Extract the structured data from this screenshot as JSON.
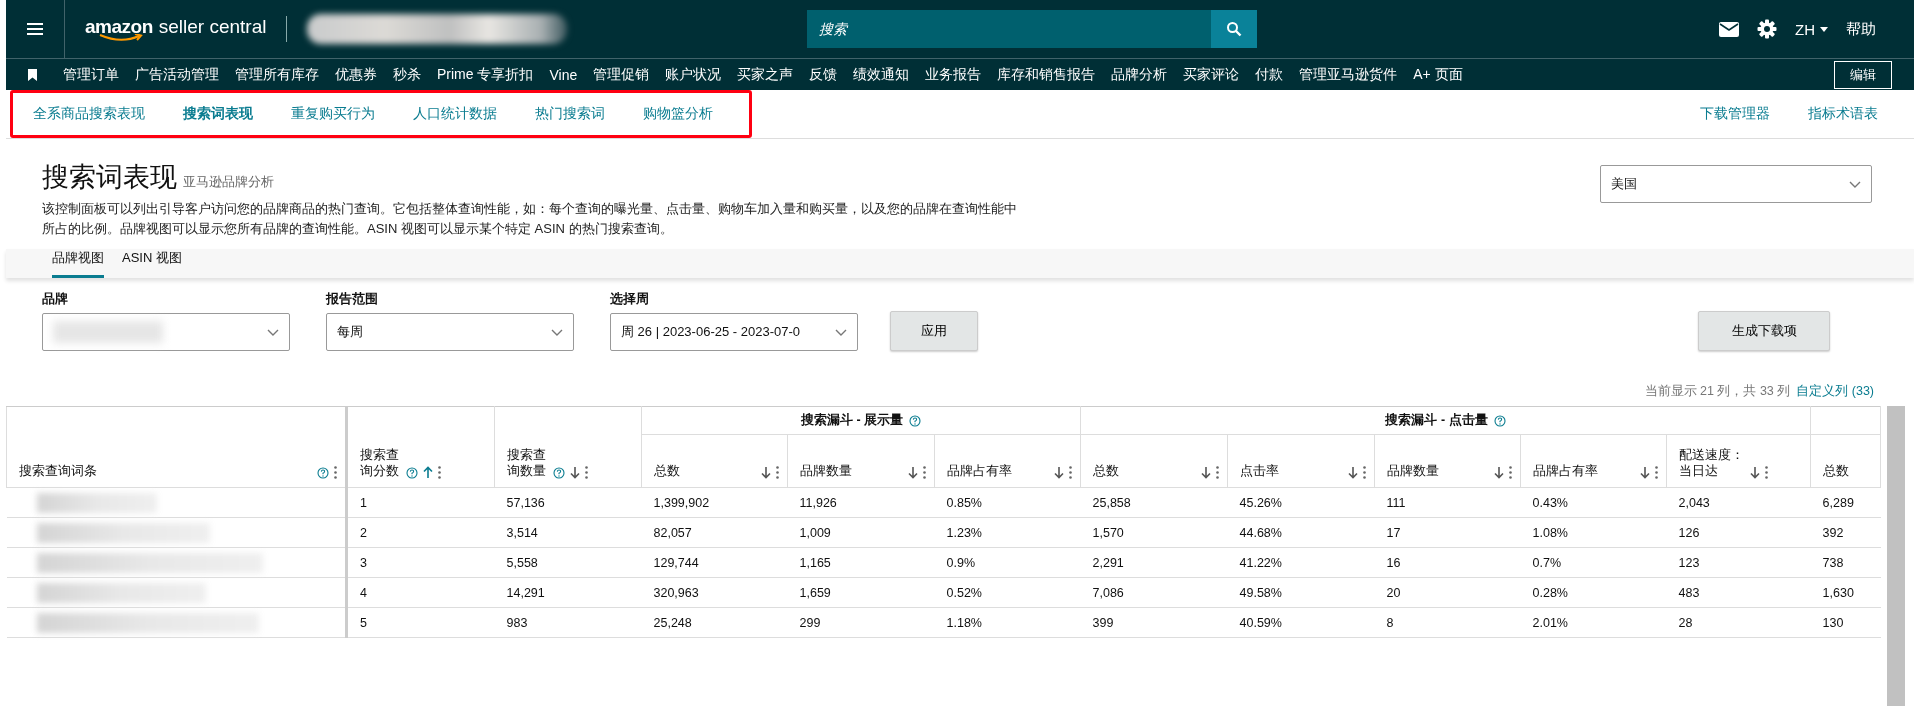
{
  "top_bar": {
    "logo_brand": "amazon",
    "logo_product": "seller central",
    "search": {
      "placeholder": "搜索"
    },
    "language": "ZH",
    "help": "帮助"
  },
  "nav": {
    "items": [
      "管理订单",
      "广告活动管理",
      "管理所有库存",
      "优惠券",
      "秒杀",
      "Prime 专享折扣",
      "Vine",
      "管理促销",
      "账户状况",
      "买家之声",
      "反馈",
      "绩效通知",
      "业务报告",
      "库存和销售报告",
      "品牌分析",
      "买家评论",
      "付款",
      "管理亚马逊货件",
      "A+ 页面"
    ],
    "edit_button": "编辑"
  },
  "subnav": {
    "highlighted": true,
    "items": [
      {
        "label": "全系商品搜索表现",
        "selected": false
      },
      {
        "label": "搜索词表现",
        "selected": true
      },
      {
        "label": "重复购买行为",
        "selected": false
      },
      {
        "label": "人口统计数据",
        "selected": false
      },
      {
        "label": "热门搜索词",
        "selected": false
      },
      {
        "label": "购物篮分析",
        "selected": false
      }
    ],
    "links": [
      "下载管理器",
      "指标术语表"
    ]
  },
  "page": {
    "title": "搜索词表现",
    "subtitle": "亚马逊品牌分析",
    "description": "该控制面板可以列出引导客户访问您的品牌商品的热门查询。它包括整体查询性能，如：每个查询的曝光量、点击量、购物车加入量和购买量，以及您的品牌在查询性能中所占的比例。品牌视图可以显示您所有品牌的查询性能。ASIN 视图可以显示某个特定 ASIN 的热门搜索查询。",
    "marketplace": "美国"
  },
  "view_tabs": [
    {
      "label": "品牌视图",
      "selected": true
    },
    {
      "label": "ASIN 视图",
      "selected": false
    }
  ],
  "filters": [
    {
      "label": "品牌",
      "value_blurred": true
    },
    {
      "label": "报告范围",
      "value": "每周"
    },
    {
      "label": "选择周",
      "value": "周 26 | 2023-06-25 - 2023-07-0"
    }
  ],
  "apply_button": "应用",
  "generate_button": "生成下载项",
  "columns_info": {
    "text": "当前显示 21 列，共 33 列",
    "link": "自定义列 (33)"
  },
  "table": {
    "header": [
      {
        "kind": "column",
        "label": "搜索查询词条",
        "help": true,
        "menu": true
      },
      {
        "kind": "column",
        "label": "搜索查询分数",
        "help": true,
        "sorted": true,
        "menu": true
      },
      {
        "kind": "column",
        "label": "搜索查询数量",
        "help": true,
        "sorted": false,
        "menu": true
      },
      {
        "kind": "group",
        "label": "搜索漏斗 - 展示量",
        "help": true,
        "columns": [
          {
            "label": "总数",
            "sorted": false,
            "menu": true
          },
          {
            "label": "品牌数量",
            "sorted": false,
            "menu": true
          },
          {
            "label": "品牌占有率",
            "sorted": false,
            "menu": true
          }
        ]
      },
      {
        "kind": "group",
        "label": "搜索漏斗 - 点击量",
        "help": true,
        "columns": [
          {
            "label": "总数",
            "sorted": false,
            "menu": true
          },
          {
            "label": "点击率",
            "sorted": false,
            "menu": true
          },
          {
            "label": "品牌数量",
            "sorted": false,
            "menu": true
          },
          {
            "label": "品牌占有率",
            "sorted": false,
            "menu": true
          },
          {
            "label": "配送速度：当日达",
            "sorted": false,
            "menu": true
          }
        ]
      },
      {
        "kind": "group",
        "columns": [
          {
            "label": "总数",
            "menu": false
          }
        ]
      }
    ],
    "rows": [
      {
        "cells": [
          "1",
          "57,136",
          "1,399,902",
          "11,926",
          "0.85%",
          "25,858",
          "45.26%",
          "111",
          "0.43%",
          "2,043",
          "6,289"
        ]
      },
      {
        "cells": [
          "2",
          "3,514",
          "82,057",
          "1,009",
          "1.23%",
          "1,570",
          "44.68%",
          "17",
          "1.08%",
          "126",
          "392"
        ]
      },
      {
        "cells": [
          "3",
          "5,558",
          "129,744",
          "1,165",
          "0.9%",
          "2,291",
          "41.22%",
          "16",
          "0.7%",
          "123",
          "738"
        ]
      },
      {
        "cells": [
          "4",
          "14,291",
          "320,963",
          "1,659",
          "0.52%",
          "7,086",
          "49.58%",
          "20",
          "0.28%",
          "483",
          "1,630"
        ]
      },
      {
        "cells": [
          "5",
          "983",
          "25,248",
          "299",
          "1.18%",
          "399",
          "40.59%",
          "8",
          "2.01%",
          "28",
          "130"
        ]
      }
    ]
  }
}
